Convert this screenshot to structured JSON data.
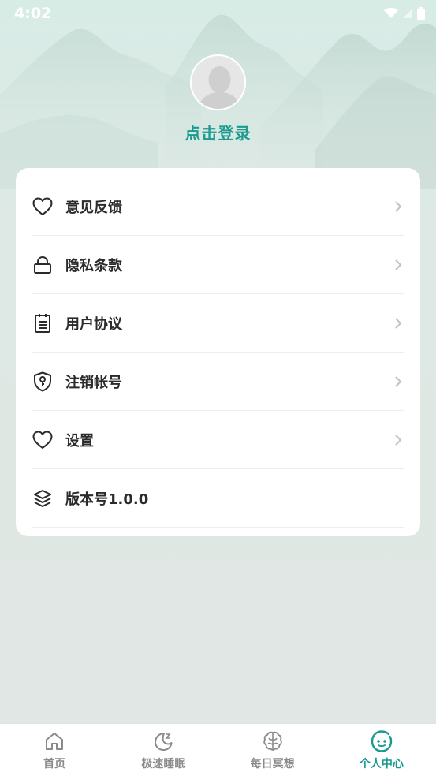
{
  "status_bar": {
    "time": "4:02"
  },
  "profile": {
    "login_text": "点击登录"
  },
  "menu": [
    {
      "label": "意见反馈",
      "icon": "heart-icon",
      "has_chevron": true
    },
    {
      "label": "隐私条款",
      "icon": "lock-icon",
      "has_chevron": true
    },
    {
      "label": "用户协议",
      "icon": "clipboard-icon",
      "has_chevron": true
    },
    {
      "label": "注销帐号",
      "icon": "shield-key-icon",
      "has_chevron": true
    },
    {
      "label": "设置",
      "icon": "heart-icon",
      "has_chevron": true
    },
    {
      "label": "版本号1.0.0",
      "icon": "layers-icon",
      "has_chevron": false
    }
  ],
  "tabs": [
    {
      "label": "首页",
      "icon": "home-icon",
      "active": false
    },
    {
      "label": "极速睡眠",
      "icon": "moon-icon",
      "active": false
    },
    {
      "label": "每日冥想",
      "icon": "brain-icon",
      "active": false
    },
    {
      "label": "个人中心",
      "icon": "smiley-icon",
      "active": true
    }
  ],
  "colors": {
    "accent": "#1a9b8f",
    "inactive_tab": "#8a8a8a",
    "text": "#2b2b2b",
    "background": "#dfe8e4"
  }
}
